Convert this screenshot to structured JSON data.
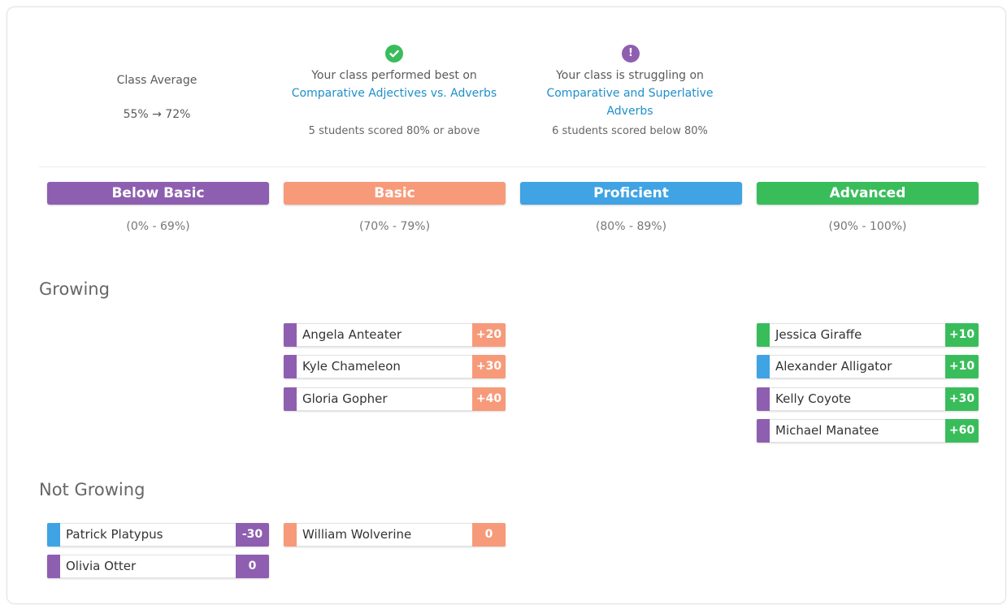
{
  "colors": {
    "below_basic": "#8e5fb0",
    "basic": "#f79a7a",
    "proficient": "#40a3e3",
    "advanced": "#39bd5b",
    "link": "#1f8fc9"
  },
  "summary": {
    "class_average": {
      "label": "Class Average",
      "value": "55% → 72%"
    },
    "best": {
      "icon": "checkmark-icon",
      "heading": "Your class performed best on",
      "topic": "Comparative Adjectives vs. Adverbs",
      "detail": "5 students scored 80% or above"
    },
    "struggling": {
      "icon": "exclamation-icon",
      "heading": "Your class is struggling on",
      "topic_line1": "Comparative and Superlative",
      "topic_line2": "Adverbs",
      "detail": "6 students scored below 80%"
    }
  },
  "bands": [
    {
      "name": "Below Basic",
      "range": "(0% - 69%)"
    },
    {
      "name": "Basic",
      "range": "(70% - 79%)"
    },
    {
      "name": "Proficient",
      "range": "(80% - 89%)"
    },
    {
      "name": "Advanced",
      "range": "(90% - 100%)"
    }
  ],
  "sections": {
    "growing": {
      "title": "Growing",
      "students": [
        {
          "name": "Angela Anteater",
          "delta": "+20",
          "prior_band": "below_basic",
          "band": "basic"
        },
        {
          "name": "Kyle Chameleon",
          "delta": "+30",
          "prior_band": "below_basic",
          "band": "basic"
        },
        {
          "name": "Gloria Gopher",
          "delta": "+40",
          "prior_band": "below_basic",
          "band": "basic"
        },
        {
          "name": "Jessica Giraffe",
          "delta": "+10",
          "prior_band": "advanced",
          "band": "advanced"
        },
        {
          "name": "Alexander Alligator",
          "delta": "+10",
          "prior_band": "proficient",
          "band": "advanced"
        },
        {
          "name": "Kelly Coyote",
          "delta": "+30",
          "prior_band": "below_basic",
          "band": "advanced"
        },
        {
          "name": "Michael Manatee",
          "delta": "+60",
          "prior_band": "below_basic",
          "band": "advanced"
        }
      ]
    },
    "not_growing": {
      "title": "Not Growing",
      "students": [
        {
          "name": "Patrick Platypus",
          "delta": "-30",
          "prior_band": "proficient",
          "band": "below_basic"
        },
        {
          "name": "Olivia Otter",
          "delta": "0",
          "prior_band": "below_basic",
          "band": "below_basic"
        },
        {
          "name": "William Wolverine",
          "delta": "0",
          "prior_band": "basic",
          "band": "basic"
        }
      ]
    }
  }
}
